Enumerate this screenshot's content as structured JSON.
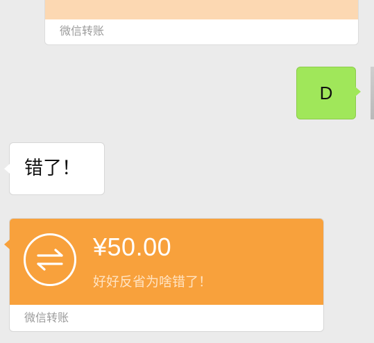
{
  "messages": {
    "top_transfer": {
      "footer_label": "微信转账"
    },
    "sent_text": {
      "text": "D"
    },
    "received_text": {
      "text": "错了！"
    },
    "received_transfer": {
      "amount": "¥50.00",
      "note": "好好反省为啥错了！",
      "footer_label": "微信转账"
    }
  },
  "icons": {
    "transfer": "transfer-arrows-icon",
    "avatar": "avatar"
  },
  "colors": {
    "background": "#ebebeb",
    "sent_bubble": "#a0e75a",
    "transfer_orange": "#f8a13c",
    "transfer_orange_faded": "#fcd8b2",
    "footer_text": "#9b9b9b"
  }
}
